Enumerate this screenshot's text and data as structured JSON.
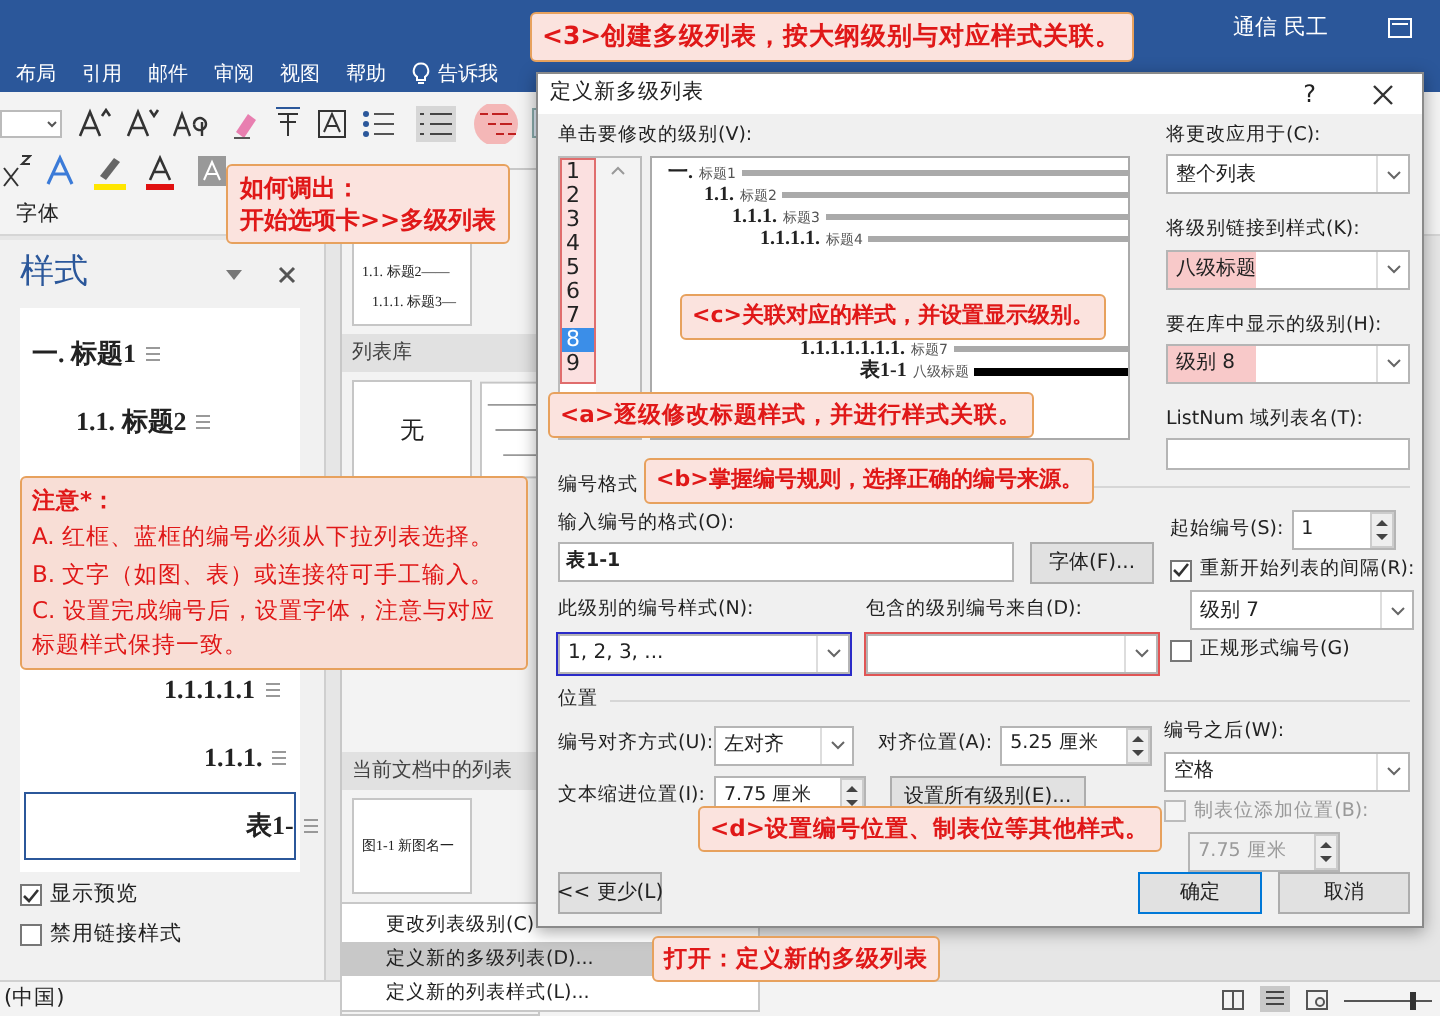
{
  "title_bar": {
    "user": "通信 民工"
  },
  "ribbon_tabs": [
    "布局",
    "引用",
    "邮件",
    "审阅",
    "视图",
    "帮助"
  ],
  "tell_me": "告诉我",
  "ribbon_group_label": "字体",
  "styles_pane": {
    "title": "样式",
    "items": [
      {
        "text": "一.  标题1",
        "selected": false
      },
      {
        "text": "1.1.  标题2",
        "selected": false
      },
      {
        "text": "1.1.1.1.1",
        "selected": false
      },
      {
        "text": "1.1.1.",
        "selected": false
      },
      {
        "text": "表1-",
        "selected": true
      }
    ],
    "options": [
      {
        "label": "显示预览",
        "checked": true
      },
      {
        "label": "禁用链接样式",
        "checked": false
      }
    ]
  },
  "list_gallery": {
    "current_tile": [
      "1.1. 标题2——",
      "1.1.1. 标题3—"
    ],
    "library_header": "列表库",
    "none_tile": "无",
    "document_header": "当前文档中的列表",
    "document_tile": "图1-1 新图名一",
    "menu": [
      {
        "label": "更改列表级别(C)",
        "selected": false
      },
      {
        "label": "定义新的多级列表(D)...",
        "selected": true
      },
      {
        "label": "定义新的列表样式(L)...",
        "selected": false
      }
    ]
  },
  "dialog": {
    "title": "定义新多级列表",
    "help": "?",
    "level_label": "单击要修改的级别(V):",
    "levels": [
      {
        "label": "1",
        "selected": false
      },
      {
        "label": "2",
        "selected": false
      },
      {
        "label": "3",
        "selected": false
      },
      {
        "label": "4",
        "selected": false
      },
      {
        "label": "5",
        "selected": false
      },
      {
        "label": "6",
        "selected": false
      },
      {
        "label": "7",
        "selected": false
      },
      {
        "label": "8",
        "selected": true
      },
      {
        "label": "9",
        "selected": false
      }
    ],
    "preview": [
      {
        "number": "一.",
        "caption": "标题1",
        "selected": false
      },
      {
        "number": "1.1.",
        "caption": "标题2",
        "selected": false
      },
      {
        "number": "1.1.1.",
        "caption": "标题3",
        "selected": false
      },
      {
        "number": "1.1.1.1.",
        "caption": "标题4",
        "selected": false
      },
      {
        "number": "1.1.1.1.1.1.1.",
        "caption": "标题7",
        "selected": false
      },
      {
        "number": "表1-1",
        "caption": "八级标题",
        "selected": true
      }
    ],
    "apply_to": {
      "label": "将更改应用于(C):",
      "value": "整个列表"
    },
    "link_style": {
      "label": "将级别链接到样式(K):",
      "value": "八级标题"
    },
    "gallery_level": {
      "label": "要在库中显示的级别(H):",
      "value": "级别 8"
    },
    "listnum": {
      "label": "ListNum 域列表名(T):"
    },
    "format_section": "编号格式",
    "format_field": {
      "label": "输入编号的格式(O):",
      "value": "表1-1"
    },
    "font_button": "字体(F)...",
    "number_style": {
      "label": "此级别的编号样式(N):",
      "value": "1, 2, 3, ..."
    },
    "include_from": {
      "label": "包含的级别编号来自(D):"
    },
    "start_at": {
      "label": "起始编号(S):",
      "value": "1"
    },
    "restart": {
      "label": "重新开始列表的间隔(R):",
      "checked": true,
      "value": "级别 7"
    },
    "legal": {
      "label": "正规形式编号(G)",
      "checked": false
    },
    "position_section": "位置",
    "alignment": {
      "label": "编号对齐方式(U):",
      "value": "左对齐"
    },
    "aligned_at": {
      "label": "对齐位置(A):",
      "value": "5.25 厘米"
    },
    "indent_at": {
      "label": "文本缩进位置(I):",
      "value": "7.75 厘米"
    },
    "set_all": "设置所有级别(E)...",
    "follow": {
      "label": "编号之后(W):",
      "value": "空格"
    },
    "tab_stop": {
      "label": "制表位添加位置(B):",
      "checked": false,
      "disabled": true,
      "value": "7.75 厘米"
    },
    "less_button": "<< 更少(L)",
    "ok_button": "确定",
    "cancel_button": "取消"
  },
  "annotations": {
    "create": "<3>创建多级列表，按大纲级别与对应样式关联。",
    "howto": [
      "如何调出：",
      "开始选项卡>>多级列表"
    ],
    "step_c": "<c>关联对应的样式，并设置显示级别。",
    "step_a": "<a>逐级修改标题样式，并进行样式关联。",
    "step_b": "<b>掌握编号规则，选择正确的编号来源。",
    "step_d": "<d>设置编号位置、制表位等其他样式。",
    "open": "打开：定义新的多级列表",
    "caution": {
      "title": "注意*：",
      "lines": [
        "A. 红框、蓝框的编号必须从下拉列表选择。",
        "B. 文字（如图、表）或连接符可手工输入。",
        "C. 设置完成编号后，设置字体，注意与对应标题样式保持一致。"
      ]
    }
  },
  "status_bar": {
    "language": "(中国)",
    "zoom": {
      "level": 0.8
    }
  }
}
